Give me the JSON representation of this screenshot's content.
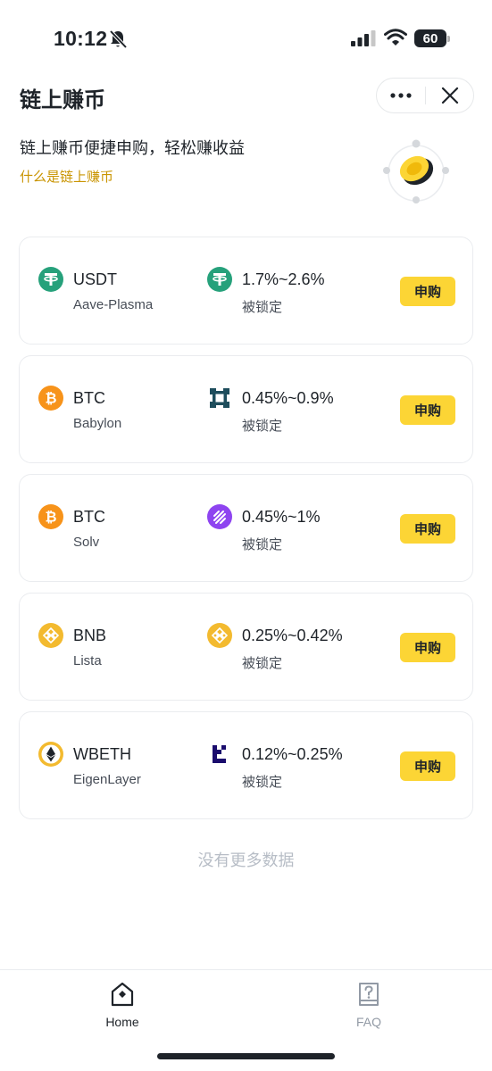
{
  "status_bar": {
    "time": "10:12",
    "battery": "60",
    "icons": [
      "bell-slash-icon",
      "signal-icon",
      "wifi-icon",
      "battery-icon"
    ]
  },
  "header": {
    "title": "链上赚币",
    "more_icon": "more-icon",
    "close_icon": "close-icon"
  },
  "intro": {
    "subtitle": "链上赚币便捷申购，轻松赚收益",
    "link": "什么是链上赚币"
  },
  "products": [
    {
      "asset": "USDT",
      "protocol": "Aave-Plasma",
      "apr": "1.7%~2.6%",
      "lock": "被锁定",
      "button": "申购",
      "asset_icon": "tether-icon",
      "protocol_icon": "tether-icon"
    },
    {
      "asset": "BTC",
      "protocol": "Babylon",
      "apr": "0.45%~0.9%",
      "lock": "被锁定",
      "button": "申购",
      "asset_icon": "bitcoin-icon",
      "protocol_icon": "babylon-icon"
    },
    {
      "asset": "BTC",
      "protocol": "Solv",
      "apr": "0.45%~1%",
      "lock": "被锁定",
      "button": "申购",
      "asset_icon": "bitcoin-icon",
      "protocol_icon": "solv-icon"
    },
    {
      "asset": "BNB",
      "protocol": "Lista",
      "apr": "0.25%~0.42%",
      "lock": "被锁定",
      "button": "申购",
      "asset_icon": "bnb-icon",
      "protocol_icon": "bnb-icon"
    },
    {
      "asset": "WBETH",
      "protocol": "EigenLayer",
      "apr": "0.12%~0.25%",
      "lock": "被锁定",
      "button": "申购",
      "asset_icon": "ethereum-icon",
      "protocol_icon": "eigenlayer-icon"
    }
  ],
  "footer_text": "没有更多数据",
  "nav": {
    "home_label": "Home",
    "faq_label": "FAQ"
  },
  "colors": {
    "accent_yellow": "#fcd535",
    "link_gold": "#c99400",
    "tether_green": "#26a17b",
    "bitcoin_orange": "#f7931a",
    "bnb_yellow": "#f3ba2f",
    "solv_purple": "#8e44f0"
  }
}
